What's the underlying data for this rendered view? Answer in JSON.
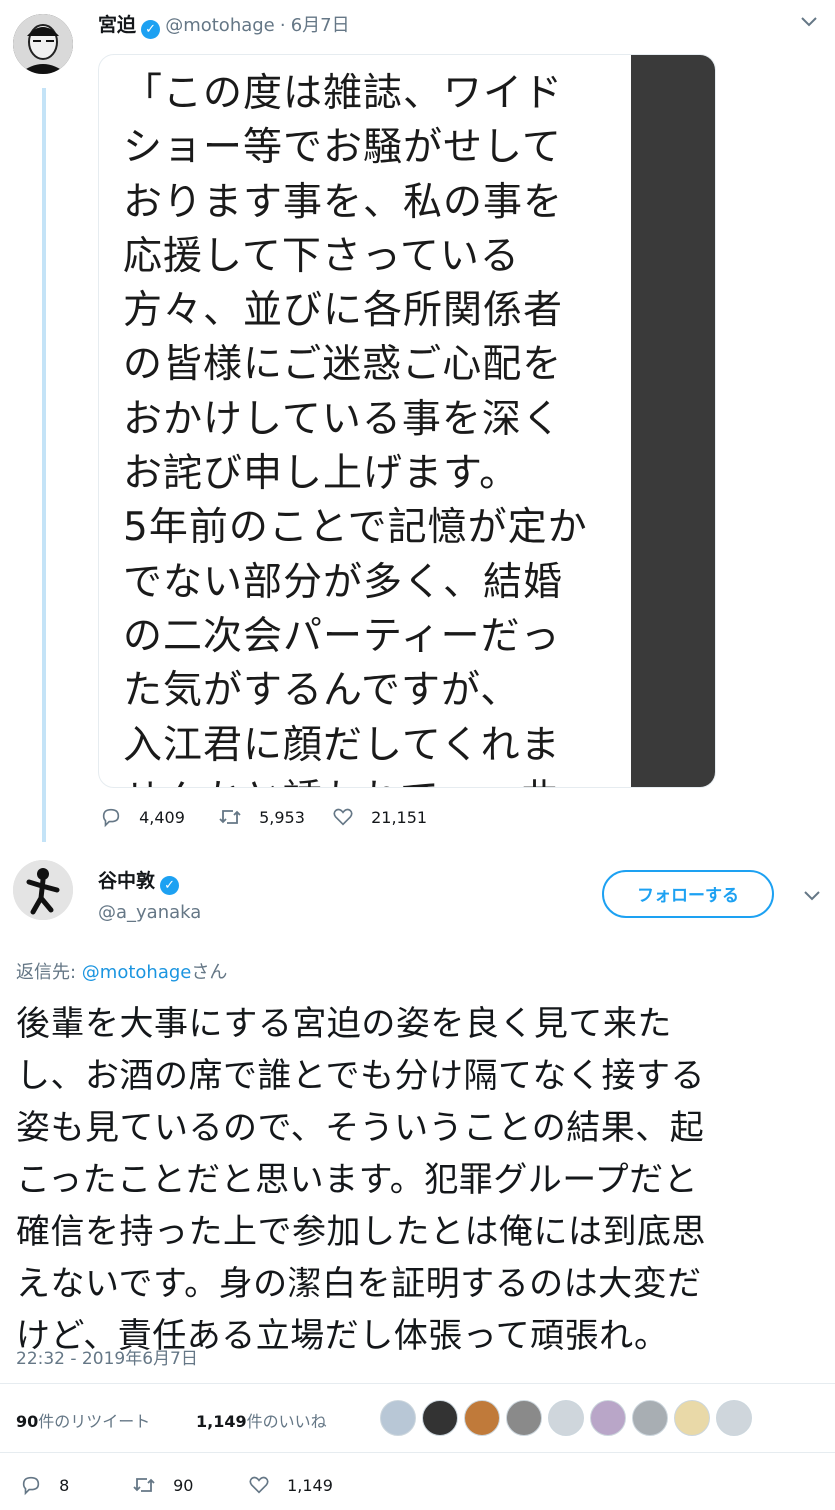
{
  "tweet1": {
    "name": "宮迫",
    "handle": "@motohage",
    "date": "6月7日",
    "media_text": [
      "「この度は雑誌、ワイド",
      "ショー等でお騒がせして",
      "おります事を、私の事を",
      "応援して下さっている",
      "方々、並びに各所関係者",
      "の皆様にご迷惑ご心配を",
      "おかけしている事を深く",
      "お詫び申し上げます。",
      "5年前のことで記憶が定か",
      "でない部分が多く、結婚",
      "の二次会パーティーだっ",
      "た気がするんですが、",
      "入江君に顔だしてくれま",
      "せんかと誘われて…一曲"
    ],
    "replies": "4,409",
    "retweets": "5,953",
    "likes": "21,151"
  },
  "tweet2": {
    "name": "谷中敦",
    "handle": "@a_yanaka",
    "follow_label": "フォローする",
    "reply_prefix": "返信先: ",
    "reply_handle": "@motohage",
    "reply_suffix": "さん",
    "text_lines": [
      "後輩を大事にする宮迫の姿を良く見て来た",
      "し、お酒の席で誰とでも分け隔てなく接する",
      "姿も見ているので、そういうことの結果、起",
      "こったことだと思います。犯罪グループだと",
      "確信を持った上で参加したとは俺には到底思",
      "えないです。身の潔白を証明するのは大変だ",
      "けど、責任ある立場だし体張って頑張れ。"
    ],
    "timestamp": "22:32 - 2019年6月7日",
    "retweet_count": "90",
    "retweet_label": "件のリツイート",
    "like_count": "1,149",
    "like_label": "件のいいね",
    "replies": "8",
    "retweets": "90",
    "likes": "1,149"
  },
  "icons": {
    "reply": "reply-icon",
    "retweet": "retweet-icon",
    "like": "heart-icon",
    "verified": "verified-badge-icon",
    "more": "chevron-down-icon"
  },
  "colors": {
    "accent": "#1da1f2",
    "muted": "#657786",
    "thread_line": "#c4e3f7"
  }
}
